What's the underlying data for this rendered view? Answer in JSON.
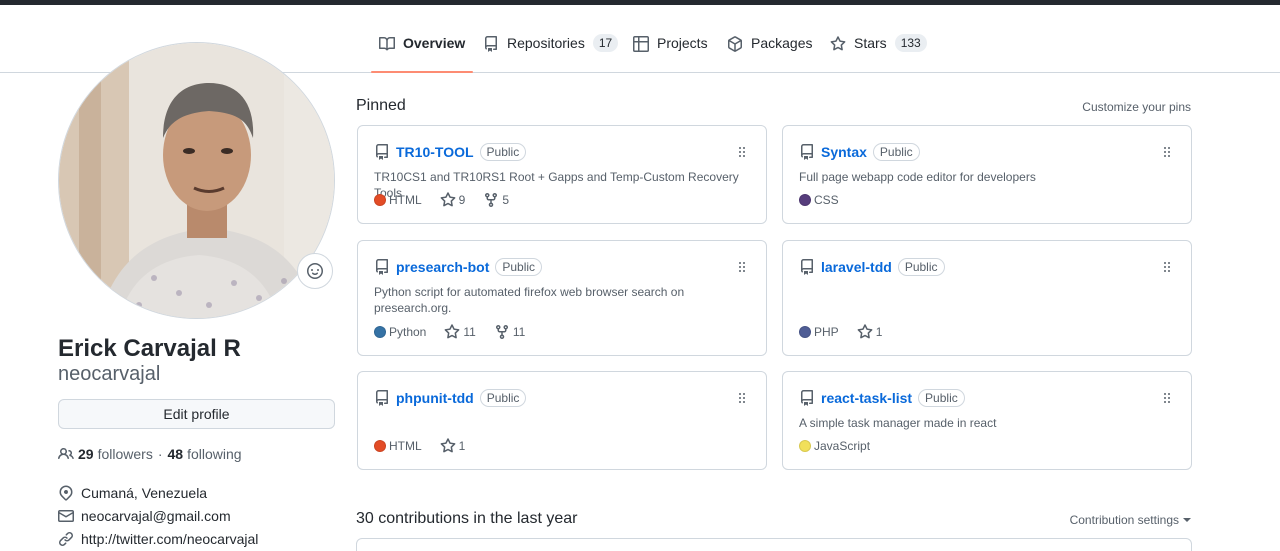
{
  "nav": {
    "tabs": [
      {
        "label": "Overview",
        "icon": "book-icon"
      },
      {
        "label": "Repositories",
        "count": "17",
        "icon": "repo-icon"
      },
      {
        "label": "Projects",
        "icon": "table-icon"
      },
      {
        "label": "Packages",
        "icon": "package-icon"
      },
      {
        "label": "Stars",
        "count": "133",
        "icon": "star-icon"
      }
    ]
  },
  "profile": {
    "name": "Erick Carvajal R",
    "username": "neocarvajal",
    "edit_label": "Edit profile",
    "followers_count": "29",
    "followers_label": "followers",
    "separator": "·",
    "following_count": "48",
    "following_label": "following",
    "location": "Cumaná, Venezuela",
    "email": "neocarvajal@gmail.com",
    "url": "http://twitter.com/neocarvajal"
  },
  "pinned": {
    "title": "Pinned",
    "customize_label": "Customize your pins",
    "repos": [
      {
        "name": "TR10-TOOL",
        "visibility": "Public",
        "description": "TR10CS1 and TR10RS1 Root + Gapps and Temp-Custom Recovery Tools",
        "language": "HTML",
        "lang_color": "#e34c26",
        "stars": "9",
        "forks": "5"
      },
      {
        "name": "Syntax",
        "visibility": "Public",
        "description": "Full page webapp code editor for developers",
        "language": "CSS",
        "lang_color": "#563d7c"
      },
      {
        "name": "presearch-bot",
        "visibility": "Public",
        "description": "Python script for automated firefox web browser search on presearch.org.",
        "language": "Python",
        "lang_color": "#3572A5",
        "stars": "11",
        "forks": "11"
      },
      {
        "name": "laravel-tdd",
        "visibility": "Public",
        "description": "",
        "language": "PHP",
        "lang_color": "#4F5D95",
        "stars": "1"
      },
      {
        "name": "phpunit-tdd",
        "visibility": "Public",
        "description": "",
        "language": "HTML",
        "lang_color": "#e34c26",
        "stars": "1"
      },
      {
        "name": "react-task-list",
        "visibility": "Public",
        "description": "A simple task manager made in react",
        "language": "JavaScript",
        "lang_color": "#f1e05a"
      }
    ]
  },
  "contributions": {
    "title": "30 contributions in the last year",
    "settings_label": "Contribution settings"
  }
}
